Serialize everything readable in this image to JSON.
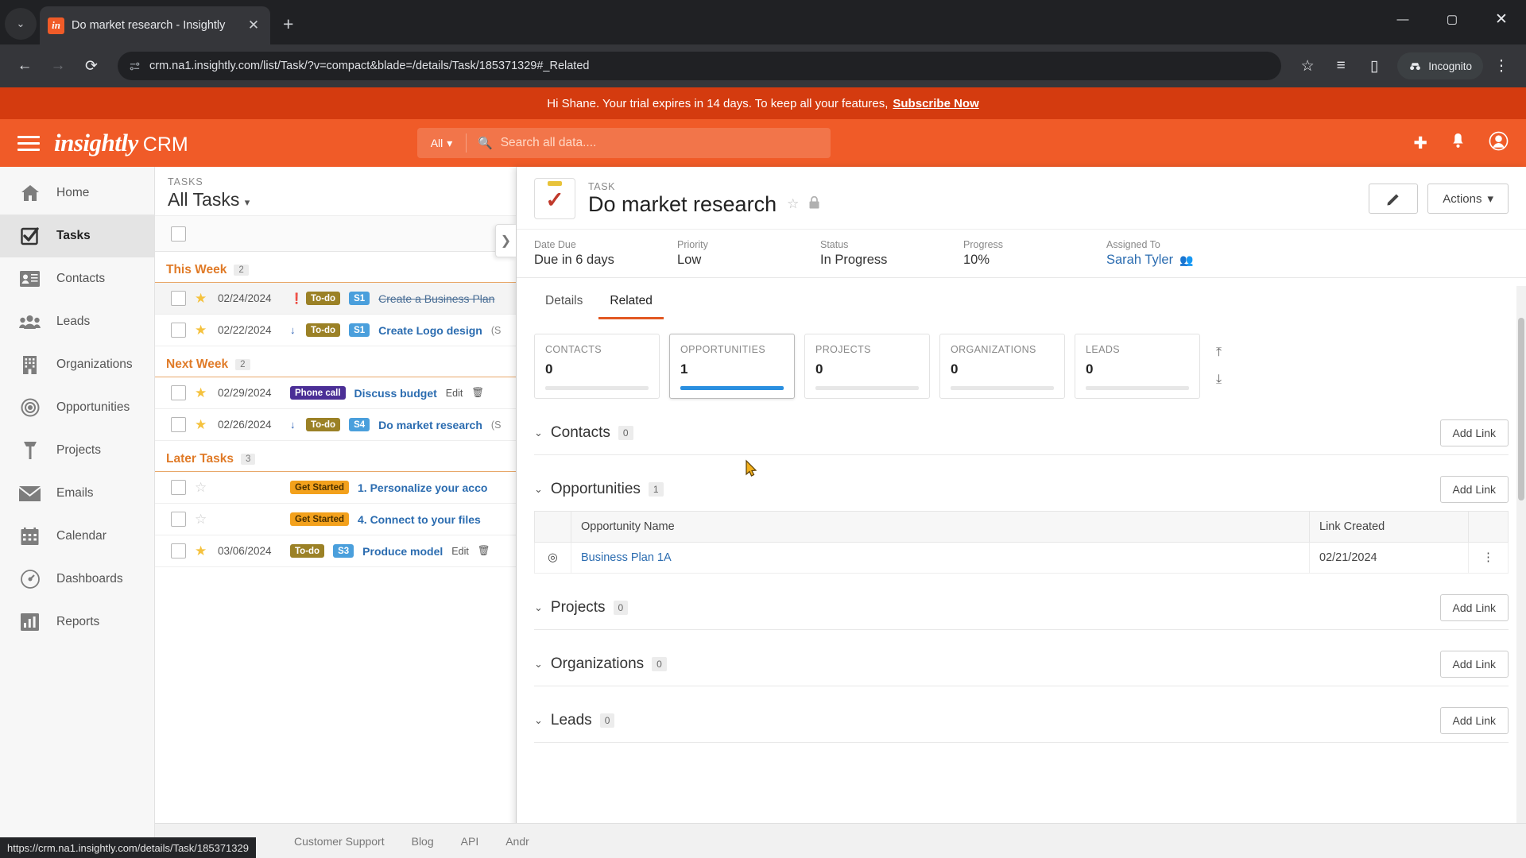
{
  "browser": {
    "tab": {
      "title": "Do market research - Insightly",
      "favicon_label": "in",
      "close_label": "✕"
    },
    "new_tab_label": "+",
    "tab_list_caret": "⌄",
    "window": {
      "minimize": "—",
      "maximize": "▢",
      "close": "✕"
    },
    "nav": {
      "back": "←",
      "forward": "→",
      "reload": "⟳"
    },
    "url": "crm.na1.insightly.com/list/Task/?v=compact&blade=/details/Task/185371329#_Related",
    "bookmark_icon": "☆",
    "right_icons": {
      "reading_list": "≡",
      "side_panel": "▯",
      "menu": "⋮"
    },
    "incognito_label": "Incognito",
    "status_url": "https://crm.na1.insightly.com/details/Task/185371329"
  },
  "banner": {
    "text": "Hi Shane. Your trial expires in 14 days. To keep all your features,",
    "link": "Subscribe Now"
  },
  "header": {
    "brand": "insightly",
    "product": "CRM",
    "search_scope": "All",
    "search_placeholder": "Search all data....",
    "add_icon": "✚",
    "bell_icon": "🔔",
    "avatar_icon": "◕"
  },
  "sidebar": {
    "items": [
      {
        "label": "Home",
        "icon": "home-icon",
        "glyph": "⌂",
        "active": false
      },
      {
        "label": "Tasks",
        "icon": "tasks-icon",
        "glyph": "☑",
        "active": true
      },
      {
        "label": "Contacts",
        "icon": "contacts-icon",
        "glyph": "▤",
        "active": false
      },
      {
        "label": "Leads",
        "icon": "leads-icon",
        "glyph": "👥",
        "active": false
      },
      {
        "label": "Organizations",
        "icon": "organizations-icon",
        "glyph": "🏢",
        "active": false
      },
      {
        "label": "Opportunities",
        "icon": "opportunities-icon",
        "glyph": "◎",
        "active": false
      },
      {
        "label": "Projects",
        "icon": "projects-icon",
        "glyph": "⊤",
        "active": false
      },
      {
        "label": "Emails",
        "icon": "emails-icon",
        "glyph": "✉",
        "active": false
      },
      {
        "label": "Calendar",
        "icon": "calendar-icon",
        "glyph": "▦",
        "active": false
      },
      {
        "label": "Dashboards",
        "icon": "dashboards-icon",
        "glyph": "◔",
        "active": false
      },
      {
        "label": "Reports",
        "icon": "reports-icon",
        "glyph": "▥",
        "active": false
      }
    ]
  },
  "list_panel": {
    "kicker": "TASKS",
    "title": "All Tasks",
    "caret": "▾",
    "collapse_icon": "❯",
    "groups": [
      {
        "name": "This Week",
        "count": "2",
        "rows": [
          {
            "date": "02/24/2024",
            "starred": true,
            "priority_icon": "❗",
            "priority_high": true,
            "badges": [
              {
                "text": "To-do",
                "kind": "todo"
              },
              {
                "text": "S1",
                "kind": "stage"
              }
            ],
            "name": "Create a Business Plan",
            "completed": true,
            "meta": "",
            "selected": true
          },
          {
            "date": "02/22/2024",
            "starred": true,
            "priority_icon": "↓",
            "priority_high": false,
            "badges": [
              {
                "text": "To-do",
                "kind": "todo"
              },
              {
                "text": "S1",
                "kind": "stage"
              }
            ],
            "name": "Create Logo design",
            "completed": false,
            "meta": "(S",
            "selected": false
          }
        ]
      },
      {
        "name": "Next Week",
        "count": "2",
        "rows": [
          {
            "date": "02/29/2024",
            "starred": true,
            "priority_icon": "",
            "priority_high": false,
            "badges": [
              {
                "text": "Phone call",
                "kind": "phone"
              }
            ],
            "name": "Discuss budget",
            "completed": false,
            "meta": "Edit",
            "selected": false
          },
          {
            "date": "02/26/2024",
            "starred": true,
            "priority_icon": "↓",
            "priority_high": false,
            "badges": [
              {
                "text": "To-do",
                "kind": "todo"
              },
              {
                "text": "S4",
                "kind": "stage"
              }
            ],
            "name": "Do market research",
            "completed": false,
            "meta": "(S",
            "selected": false
          }
        ]
      },
      {
        "name": "Later Tasks",
        "count": "3",
        "rows": [
          {
            "date": "",
            "starred": false,
            "priority_icon": "",
            "priority_high": false,
            "badges": [
              {
                "text": "Get Started",
                "kind": "get"
              }
            ],
            "name": "1. Personalize your acco",
            "completed": false,
            "meta": "",
            "selected": false
          },
          {
            "date": "",
            "starred": false,
            "priority_icon": "",
            "priority_high": false,
            "badges": [
              {
                "text": "Get Started",
                "kind": "get"
              }
            ],
            "name": "4. Connect to your files",
            "completed": false,
            "meta": "",
            "selected": false
          },
          {
            "date": "03/06/2024",
            "starred": true,
            "priority_icon": "",
            "priority_high": false,
            "badges": [
              {
                "text": "To-do",
                "kind": "todo"
              },
              {
                "text": "S3",
                "kind": "stage"
              }
            ],
            "name": "Produce model",
            "completed": false,
            "meta": "Edit",
            "selected": false
          }
        ]
      }
    ]
  },
  "blade": {
    "kicker": "TASK",
    "title": "Do market research",
    "star_icon": "☆",
    "lock_icon": "🔒",
    "edit_icon": "✎",
    "actions_label": "Actions",
    "actions_caret": "▾",
    "meta": [
      {
        "label": "Date Due",
        "value": "Due in 6 days",
        "link": false
      },
      {
        "label": "Priority",
        "value": "Low",
        "link": false
      },
      {
        "label": "Status",
        "value": "In Progress",
        "link": false
      },
      {
        "label": "Progress",
        "value": "10%",
        "link": false
      },
      {
        "label": "Assigned To",
        "value": "Sarah Tyler",
        "link": true
      }
    ],
    "tabs": [
      {
        "label": "Details",
        "active": false
      },
      {
        "label": "Related",
        "active": true
      }
    ],
    "stat_cards": [
      {
        "label": "CONTACTS",
        "value": "0",
        "filled": false
      },
      {
        "label": "OPPORTUNITIES",
        "value": "1",
        "filled": true
      },
      {
        "label": "PROJECTS",
        "value": "0",
        "filled": false
      },
      {
        "label": "ORGANIZATIONS",
        "value": "0",
        "filled": false
      },
      {
        "label": "LEADS",
        "value": "0",
        "filled": false
      }
    ],
    "stat_nav": {
      "up": "⤒",
      "down": "⤓"
    },
    "sections": [
      {
        "title": "Contacts",
        "count": "0",
        "add_label": "Add Link",
        "has_table": false
      },
      {
        "title": "Opportunities",
        "count": "1",
        "add_label": "Add Link",
        "has_table": true,
        "columns": [
          "Opportunity Name",
          "Link Created"
        ],
        "rows": [
          {
            "icon": "◎",
            "name": "Business Plan 1A",
            "link_created": "02/21/2024",
            "menu": "⋮"
          }
        ]
      },
      {
        "title": "Projects",
        "count": "0",
        "add_label": "Add Link",
        "has_table": false
      },
      {
        "title": "Organizations",
        "count": "0",
        "add_label": "Add Link",
        "has_table": false
      },
      {
        "title": "Leads",
        "count": "0",
        "add_label": "Add Link",
        "has_table": false
      }
    ]
  },
  "footer": {
    "links": [
      "Customer Support",
      "Blog",
      "API",
      "Andr"
    ]
  }
}
